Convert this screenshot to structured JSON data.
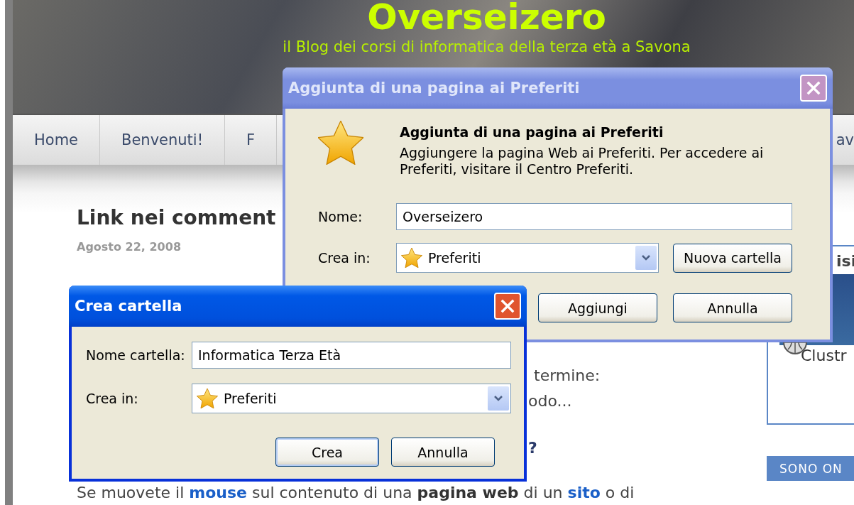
{
  "background_page": {
    "header": {
      "title": "Overseizero",
      "subtitle": "il Blog dei corsi di informatica della terza età a Savona"
    },
    "nav": [
      {
        "label": "Home"
      },
      {
        "label": "Benvenuti!"
      },
      {
        "label": "F"
      },
      {
        "label": "av"
      }
    ],
    "post": {
      "title": "Link nei comment",
      "date": "Agosto 22, 2008",
      "fragments": [
        {
          "kind": "text",
          "text": "termine:"
        },
        {
          "kind": "text",
          "text": "odo..."
        },
        {
          "kind": "heading",
          "text": "?"
        }
      ],
      "paragraph": [
        {
          "kind": "text",
          "text": "Se muovete il "
        },
        {
          "kind": "link",
          "text": "mouse"
        },
        {
          "kind": "text",
          "text": " sul contenuto di una "
        },
        {
          "kind": "bold",
          "text": "pagina web"
        },
        {
          "kind": "text",
          "text": " di un "
        },
        {
          "kind": "link",
          "text": "sito"
        },
        {
          "kind": "text",
          "text": " o di"
        }
      ]
    },
    "sidebar": {
      "widget_title": "isi",
      "map_label": "Clustr",
      "section_title": "SONO ON"
    }
  },
  "add_favorite_dialog": {
    "title": "Aggiunta di una pagina ai Preferiti",
    "active": false,
    "heading": "Aggiunta di una pagina ai Preferiti",
    "description": "Aggiungere la pagina Web ai Preferiti. Per accedere ai Preferiti, visitare il Centro Preferiti.",
    "name_field": {
      "label": "Nome:",
      "value": "Overseizero"
    },
    "location_field": {
      "label": "Crea in:",
      "value": "Preferiti"
    },
    "new_folder_button": "Nuova cartella",
    "buttons": [
      {
        "label": "Aggiungi",
        "default": false
      },
      {
        "label": "Annulla",
        "default": false
      }
    ]
  },
  "new_folder_dialog": {
    "title": "Crea cartella",
    "active": true,
    "name_field": {
      "label": "Nome cartella:",
      "value": "Informatica Terza Età"
    },
    "location_field": {
      "label": "Crea in:",
      "value": "Preferiti"
    },
    "buttons": [
      {
        "label": "Crea",
        "default": true
      },
      {
        "label": "Annulla",
        "default": false
      }
    ]
  }
}
